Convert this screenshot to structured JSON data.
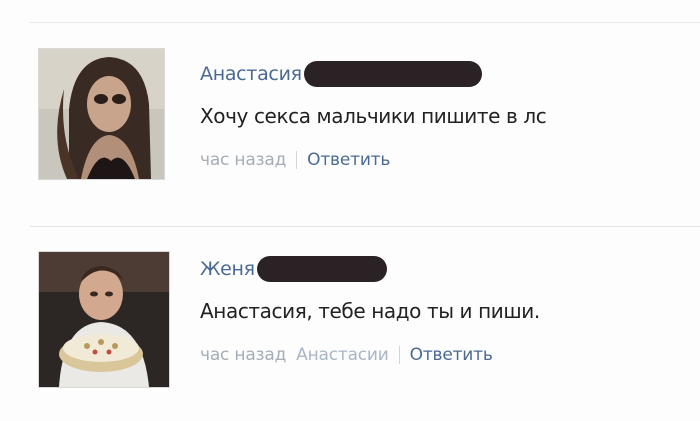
{
  "comments": [
    {
      "author": "Анастасия",
      "text": "Хочу секса мальчики пишите в лс",
      "time": "час назад",
      "reply_to": "",
      "reply_label": "Ответить"
    },
    {
      "author": "Женя",
      "text": "Анастасия, тебе надо ты и пиши.",
      "time": "час назад",
      "reply_to": "Анастасии",
      "reply_label": "Ответить"
    }
  ],
  "colors": {
    "link": "#4a6a94",
    "meta": "#a4adb8",
    "redaction": "#2a2224"
  }
}
